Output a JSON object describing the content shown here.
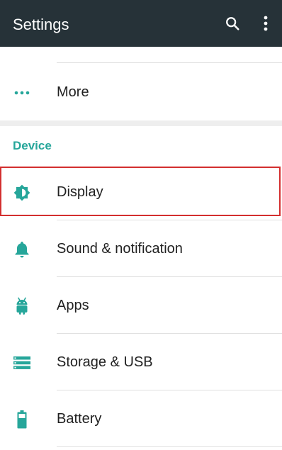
{
  "appbar": {
    "title": "Settings",
    "search_icon": "search-icon",
    "overflow_icon": "more-vert-icon"
  },
  "more": {
    "label": "More",
    "icon": "more-horiz-icon"
  },
  "device": {
    "header": "Device",
    "items": [
      {
        "label": "Display",
        "icon": "brightness-icon"
      },
      {
        "label": "Sound & notification",
        "icon": "bell-icon"
      },
      {
        "label": "Apps",
        "icon": "android-icon"
      },
      {
        "label": "Storage & USB",
        "icon": "storage-icon"
      },
      {
        "label": "Battery",
        "icon": "battery-icon"
      }
    ]
  },
  "colors": {
    "appbar": "#263238",
    "accent": "#26a69a",
    "highlight": "#d32f2f"
  }
}
